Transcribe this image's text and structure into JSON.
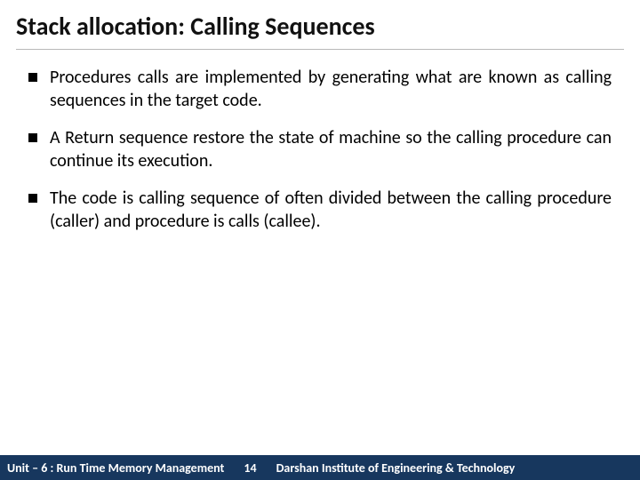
{
  "title": "Stack allocation: Calling Sequences",
  "bullets": [
    "Procedures calls are implemented by generating what are known as calling sequences in the target code.",
    "A Return sequence restore the state of machine so the calling procedure can continue its execution.",
    "The code is calling sequence of often divided between the calling procedure (caller) and procedure is calls (callee)."
  ],
  "footer": {
    "left": "Unit – 6 : Run Time Memory Management",
    "page": "14",
    "right": "Darshan Institute of Engineering & Technology"
  }
}
